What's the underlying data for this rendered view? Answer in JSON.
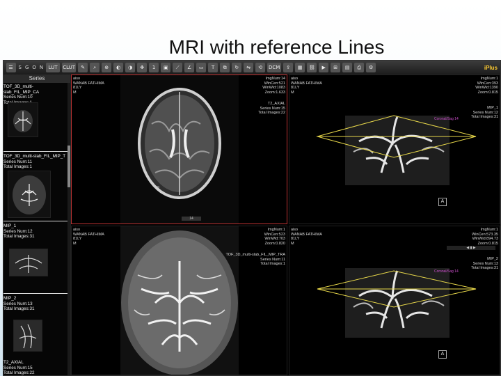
{
  "slide_title": "MRI with reference Lines",
  "toolbar": {
    "labels": [
      "S",
      "G",
      "O",
      "N",
      "LUT",
      "CLUT",
      "DCM"
    ],
    "logo_text": "iPlus"
  },
  "sidebar": {
    "header": "Series",
    "items": [
      {
        "title": "TOF_3D_multi-slab_FIL_MIP_CA",
        "series": "Series Num:10",
        "images": "Total Images:1"
      },
      {
        "title": "TOF_3D_multi-slab_FIL_MIP_T",
        "series": "Series Num:11",
        "images": "Total Images:1"
      },
      {
        "title": "MIP_1",
        "series": "Series Num:12",
        "images": "Total Images:31"
      },
      {
        "title": "MIP_2",
        "series": "Series Num:13",
        "images": "Total Images:31"
      },
      {
        "title": "T2_AXIAL",
        "series": "Series Num:15",
        "images": "Total Images:22"
      }
    ]
  },
  "viewports": {
    "top_left": {
      "tl": [
        "aiso",
        "WANAB FATHIMA",
        "81LY",
        "M"
      ],
      "tr": [
        "ImgNum:14",
        "WinCen:521",
        "WinWid:1083",
        "Zoom:1.633"
      ],
      "br": [
        "T2_AXIAL",
        "Series Num:15",
        "Total Images:22"
      ],
      "slice": "14",
      "left_marker": "R"
    },
    "top_right": {
      "tl": [
        "aiso",
        "WANAB FATHIMA",
        "81LY",
        "M"
      ],
      "tr": [
        "ImgNum:1",
        "WinCen:393",
        "WinWid:1390",
        "Zoom:0.815"
      ],
      "br": [
        "MIP_1",
        "Series Num:12",
        "Total Images:31"
      ],
      "ref_label": "Coronal/Sag 14",
      "orient": "A"
    },
    "bottom_left": {
      "tl": [
        "aiso",
        "WANAB FATHIMA",
        "81LY",
        "M"
      ],
      "tr": [
        "ImgNum:1",
        "WinCen:523",
        "WinWid:703",
        "Zoom:0.820"
      ],
      "br": [
        "TOF_3D_multi-slab_FIL_MIP_TRA",
        "Series Num:11",
        "Total Images:1"
      ]
    },
    "bottom_right": {
      "tl": [
        "aiso",
        "WANAB FATHIMA",
        "81LY",
        "M"
      ],
      "tr": [
        "ImgNum:1",
        "WinCen:573.35",
        "WinWid:894.73",
        "Zoom:0.815"
      ],
      "br": [
        "MIP_2",
        "Series Num:13",
        "Total Images:31"
      ],
      "ref_label": "Coronal/Sag 14",
      "orient": "A"
    }
  },
  "colors": {
    "reference_line": "#e8d84a",
    "active_border": "#c03333"
  }
}
